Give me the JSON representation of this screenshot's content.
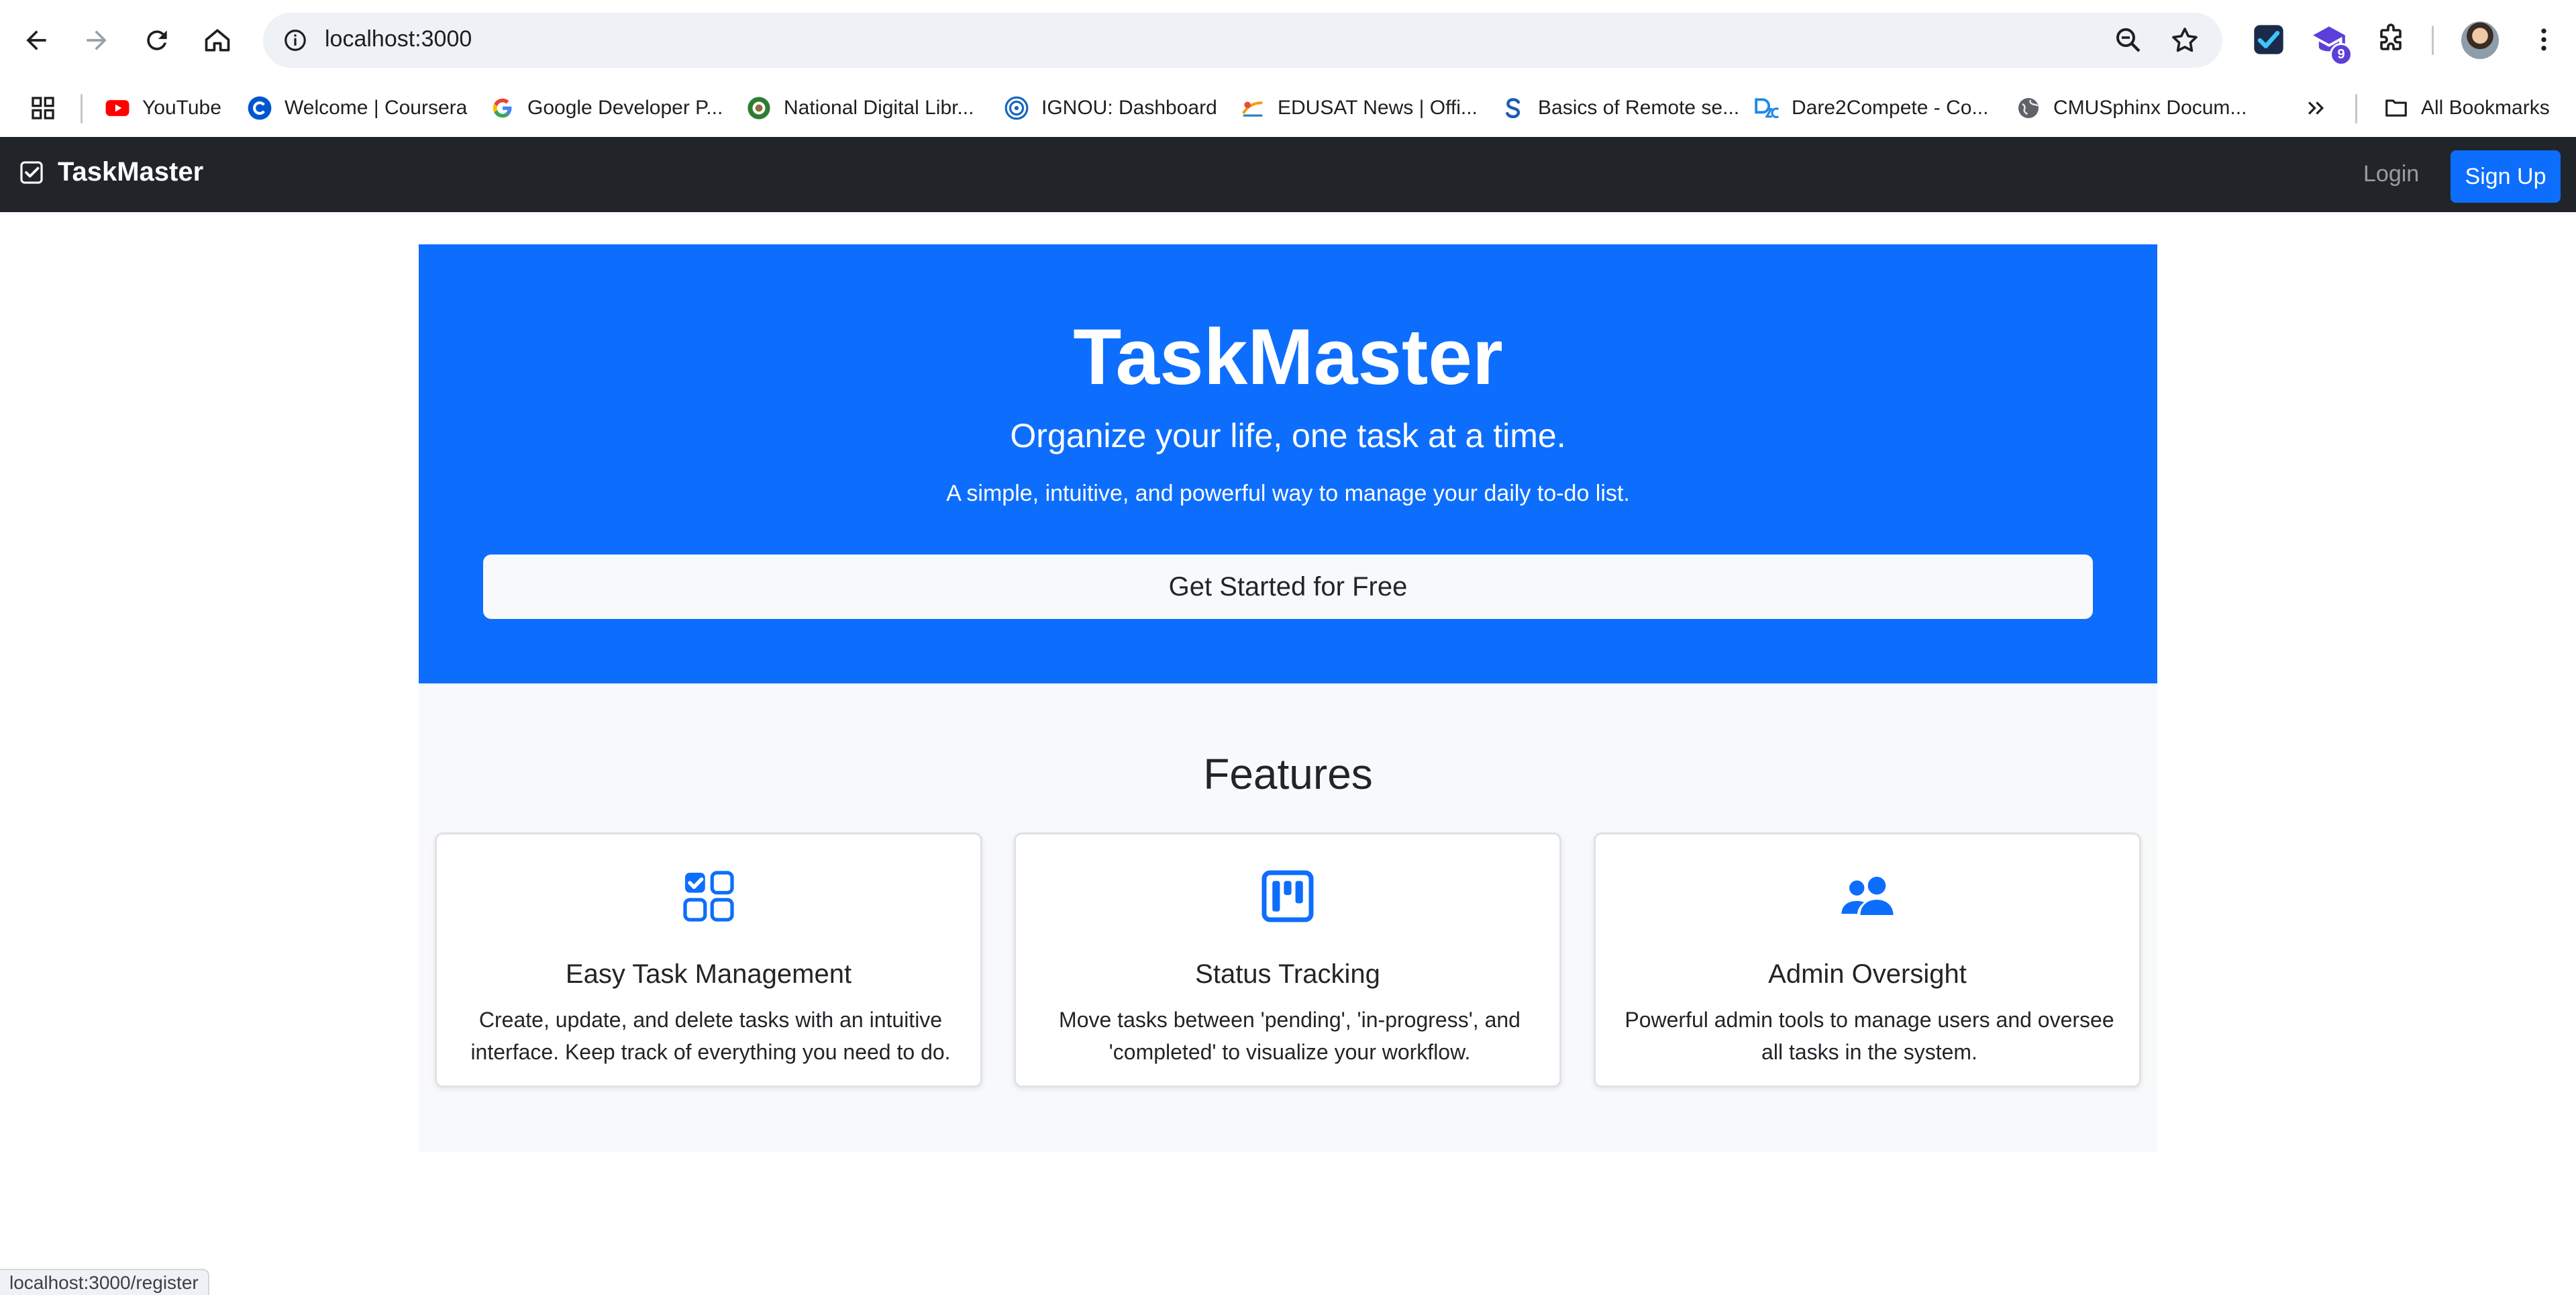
{
  "browser": {
    "url": "localhost:3000",
    "extension_badge": "9",
    "bookmarks": [
      {
        "label": "YouTube",
        "icon": "youtube-icon"
      },
      {
        "label": "Welcome | Coursera",
        "icon": "coursera-icon"
      },
      {
        "label": "Google Developer P...",
        "icon": "google-icon"
      },
      {
        "label": "National Digital Libr...",
        "icon": "ndl-icon"
      },
      {
        "label": "IGNOU: Dashboard",
        "icon": "ignou-icon"
      },
      {
        "label": "EDUSAT News | Offi...",
        "icon": "edusat-icon"
      },
      {
        "label": "Basics of Remote se...",
        "icon": "scribd-icon"
      },
      {
        "label": "Dare2Compete - Co...",
        "icon": "d2c-icon"
      },
      {
        "label": "CMUSphinx Docum...",
        "icon": "globe-icon"
      }
    ],
    "all_bookmarks_label": "All Bookmarks",
    "status_url": "localhost:3000/register"
  },
  "navbar": {
    "brand": "TaskMaster",
    "login": "Login",
    "signup": "Sign Up"
  },
  "hero": {
    "title": "TaskMaster",
    "subtitle": "Organize your life, one task at a time.",
    "lead": "A simple, intuitive, and powerful way to manage your daily to-do list.",
    "cta": "Get Started for Free"
  },
  "features": {
    "heading": "Features",
    "items": [
      {
        "icon": "task-grid-icon",
        "title": "Easy Task Management",
        "text": "Create, update, and delete tasks with an intuitive interface. Keep track of everything you need to do."
      },
      {
        "icon": "kanban-icon",
        "title": "Status Tracking",
        "text": "Move tasks between 'pending', 'in-progress', and 'completed' to visualize your workflow."
      },
      {
        "icon": "users-icon",
        "title": "Admin Oversight",
        "text": "Powerful admin tools to manage users and oversee all tasks in the system."
      }
    ]
  },
  "colors": {
    "primary": "#0d6efd",
    "navbar": "#212529",
    "features_bg": "#f8f9fa"
  }
}
